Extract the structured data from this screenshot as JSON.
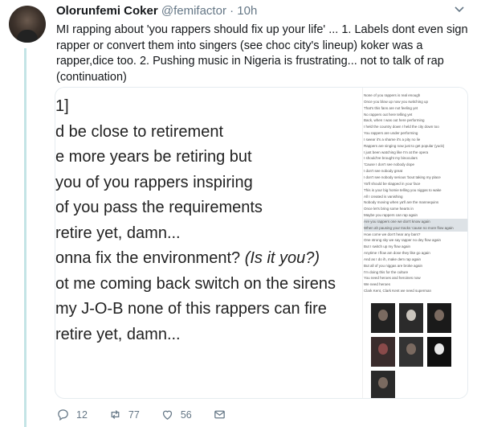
{
  "tweet": {
    "name": "Olorunfemi Coker",
    "handle": "@femifactor",
    "separator": "·",
    "time": "10h",
    "text": "MI rapping about 'you rappers should fix up your life' ... 1. Labels dont even sign rapper or convert them into singers (see choc city's lineup) koker was a rapper,dice too. 2. Pushing music in Nigeria is frustrating... not to talk of rap (continuation)"
  },
  "media": {
    "big_lines": [
      "1]",
      "d be close to retirement",
      "e more years be retiring but",
      "you of you rappers inspiring",
      "of you pass the requirements",
      "retire yet, damn...",
      "onna fix the environment? ",
      "ot me coming back switch on the sirens",
      " my J-O-B none of this rappers can fire",
      "retire yet, damn..."
    ],
    "italic_suffix": "(Is it you?)",
    "small_lines": [
      "None of you rappers is real enough",
      "Once you blow up now you switching up",
      "That's this fans are not feeling yet",
      "No rappers out here telling yet",
      "Back, when I was out here performing",
      "I held the country down I held the city down too",
      "You rappers are under performing",
      "I swear it's a shame it's a pity no lie",
      "Rappers are singing now just to get popular (yuck)",
      "I just been watching like I'm at the opera",
      "I should've brought my binoculars",
      "'Cause I don't see nobody dope",
      "I don't see nobody great",
      "I don't see nobody serious 'bout taking my place",
      "Ya'll should be slapped in your face",
      "This is your big homie telling you niggas to wake",
      "All I created is vanishing",
      "Nobody moving when ya'll are the mannequins",
      "Once let's bring some hearts in",
      "Maybe you rappers can rap again",
      "Are you rappers one we don't know again",
      "When ah pausing your tracks 'cause no more flow again",
      "How come we don't hear any bars?",
      "One strong sky we say rapper no dey flow again",
      "But I switch up my flow again",
      "Anytime I flow am dose they like go again",
      "And as I do ih, make dem rap again",
      "But all of you niggas are broke again",
      "I'm doing this for the culture",
      "You need heroes and heroines now",
      "We need heroes",
      "Clark Kent, Clark Kent we need superman"
    ]
  },
  "actions": {
    "replies": "12",
    "retweets": "77",
    "likes": "56"
  },
  "colors": {
    "thread_line": "#c4e4e6",
    "muted_text": "#657786"
  }
}
